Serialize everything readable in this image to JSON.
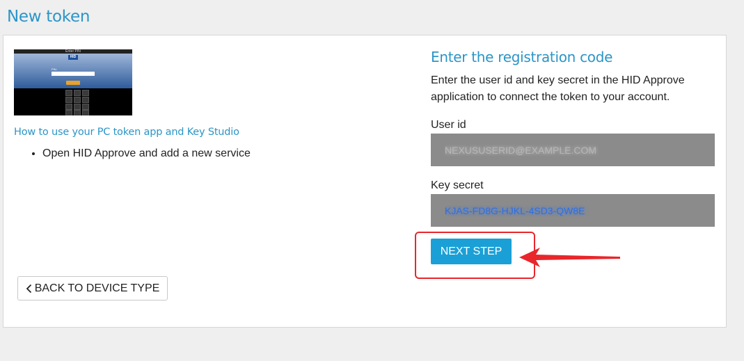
{
  "page": {
    "title": "New token"
  },
  "thumbnail": {
    "screen_title": "Enter PIN",
    "brand": "HID",
    "pin_label": "PIN:"
  },
  "help": {
    "link_text": "How to use your PC token app and Key Studio",
    "steps": [
      "Open HID Approve and add a new service"
    ]
  },
  "back_button": {
    "label": "BACK TO DEVICE TYPE",
    "icon": "chevron-left-icon"
  },
  "registration": {
    "title": "Enter the registration code",
    "description": "Enter the user id and key secret in the HID Approve application to connect the token to your account.",
    "user_id_label": "User id",
    "key_secret_label": "Key secret"
  },
  "next_button": {
    "label": "NEXT STEP"
  },
  "colors": {
    "accent": "#2b95c7",
    "button": "#1aa0d6",
    "field_bg": "#8b8b8b",
    "annotation": "#e8262b"
  }
}
